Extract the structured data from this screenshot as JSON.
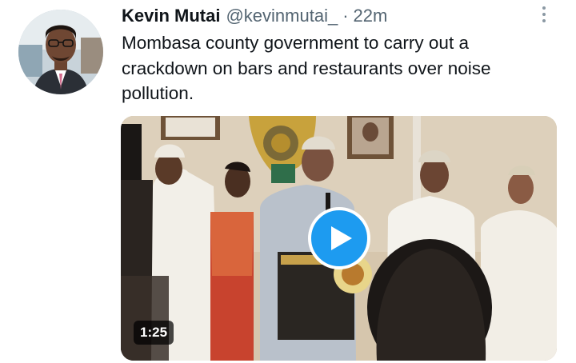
{
  "tweet": {
    "author_name": "Kevin Mutai",
    "author_handle": "@kevinmutai_",
    "separator": "·",
    "time": "22m",
    "text": "Mombasa county government to carry out a crackdown on bars and restaurants over noise pollution."
  },
  "media": {
    "type": "video",
    "duration": "1:25",
    "play_icon": "play-icon",
    "accent": "#1d9bf0"
  },
  "icons": {
    "more": "more-options-icon"
  }
}
